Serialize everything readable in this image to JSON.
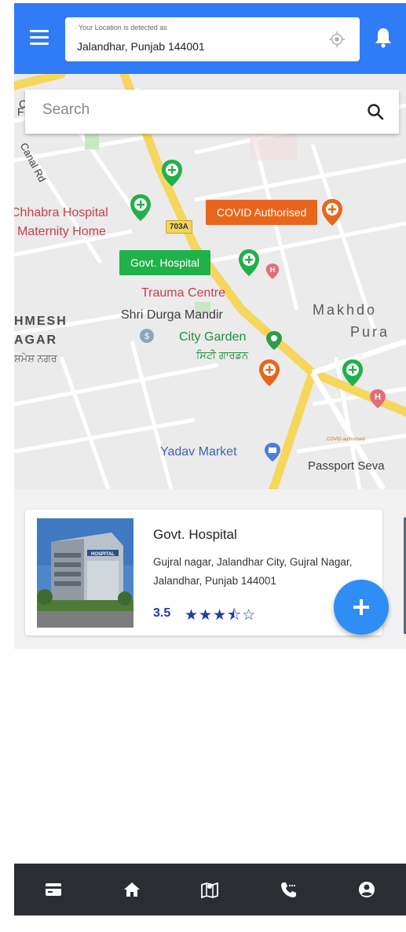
{
  "header": {
    "location_caption": "Your Location is detected as",
    "location_value": "Jalandhar, Punjab 144001",
    "bg_color": "#2f7cf6"
  },
  "search": {
    "placeholder": "Search"
  },
  "map": {
    "labels": {
      "canal_road": "Canal Rd",
      "chhabra_line1": "Chhabra Hospital",
      "chhabra_line2": "Maternity Home",
      "road_number": "703A",
      "trauma": "Trauma Centre",
      "shri_durga": "Shri Durga Mandir",
      "brahmesh_1": "HMESH",
      "brahmesh_2": "AGAR",
      "brahmesh_punjabi": "ਸ਼ਮੇਸ਼ ਨਗਰ",
      "city_garden": "City Garden",
      "city_garden_punjabi": "ਸਿਟੀ ਗਾਰਡਨ",
      "makhdoom_1": "Makhdo",
      "makhdoom_2": "Pura",
      "yadav_market": "Yadav Market",
      "passport": "Passport Seva",
      "legend_mini": "COVID authorised"
    },
    "tags": {
      "covid": "COVID Authorised",
      "govt": "Govt. Hospital"
    }
  },
  "card": {
    "title": "Govt. Hospital",
    "address": "Gujral nagar, Jalandhar City, Gujral Nagar, Jalandhar, Punjab 144001",
    "rating": "3.5",
    "rating_value": 3.5,
    "stars": "★★★⯪☆",
    "image_sign": "HOSPITAL"
  },
  "bottom_nav": {
    "items": [
      "card-icon",
      "home-icon",
      "map-icon",
      "phone-icon",
      "account-icon"
    ]
  },
  "colors": {
    "accent": "#2f7cf6",
    "green_marker": "#21b14a",
    "orange_marker": "#e8661c",
    "nav_bg": "#2a2e33",
    "rating_blue": "#1a3fa0"
  }
}
